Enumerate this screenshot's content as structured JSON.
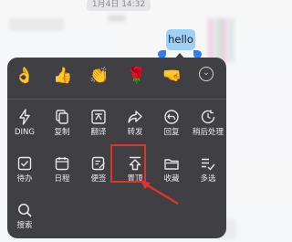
{
  "chat": {
    "timestamp": "1月4日 14:32",
    "message_text": "hello"
  },
  "menu": {
    "emojis": [
      {
        "name": "ok-hand-emoji",
        "glyph": "👌"
      },
      {
        "name": "thumbs-up-emoji",
        "glyph": "👍"
      },
      {
        "name": "clap-emoji",
        "glyph": "👏"
      },
      {
        "name": "flower-emoji",
        "glyph": "🌹"
      },
      {
        "name": "fist-bump-emoji",
        "glyph": "🤜"
      }
    ],
    "actions_row1": [
      "DING",
      "复制",
      "翻译",
      "转发",
      "回复",
      "稍后处理"
    ],
    "actions_row2": [
      "待办",
      "日程",
      "便签",
      "置顶",
      "收藏",
      "多选"
    ],
    "actions_row3": [
      "搜索"
    ]
  },
  "annotation": {
    "highlighted_action": "置顶",
    "color": "#e0332a"
  },
  "colors": {
    "popup_bg": "#3f3f44",
    "bubble_bg": "#9fd0f7",
    "selection_handle": "#2f7ff3"
  }
}
